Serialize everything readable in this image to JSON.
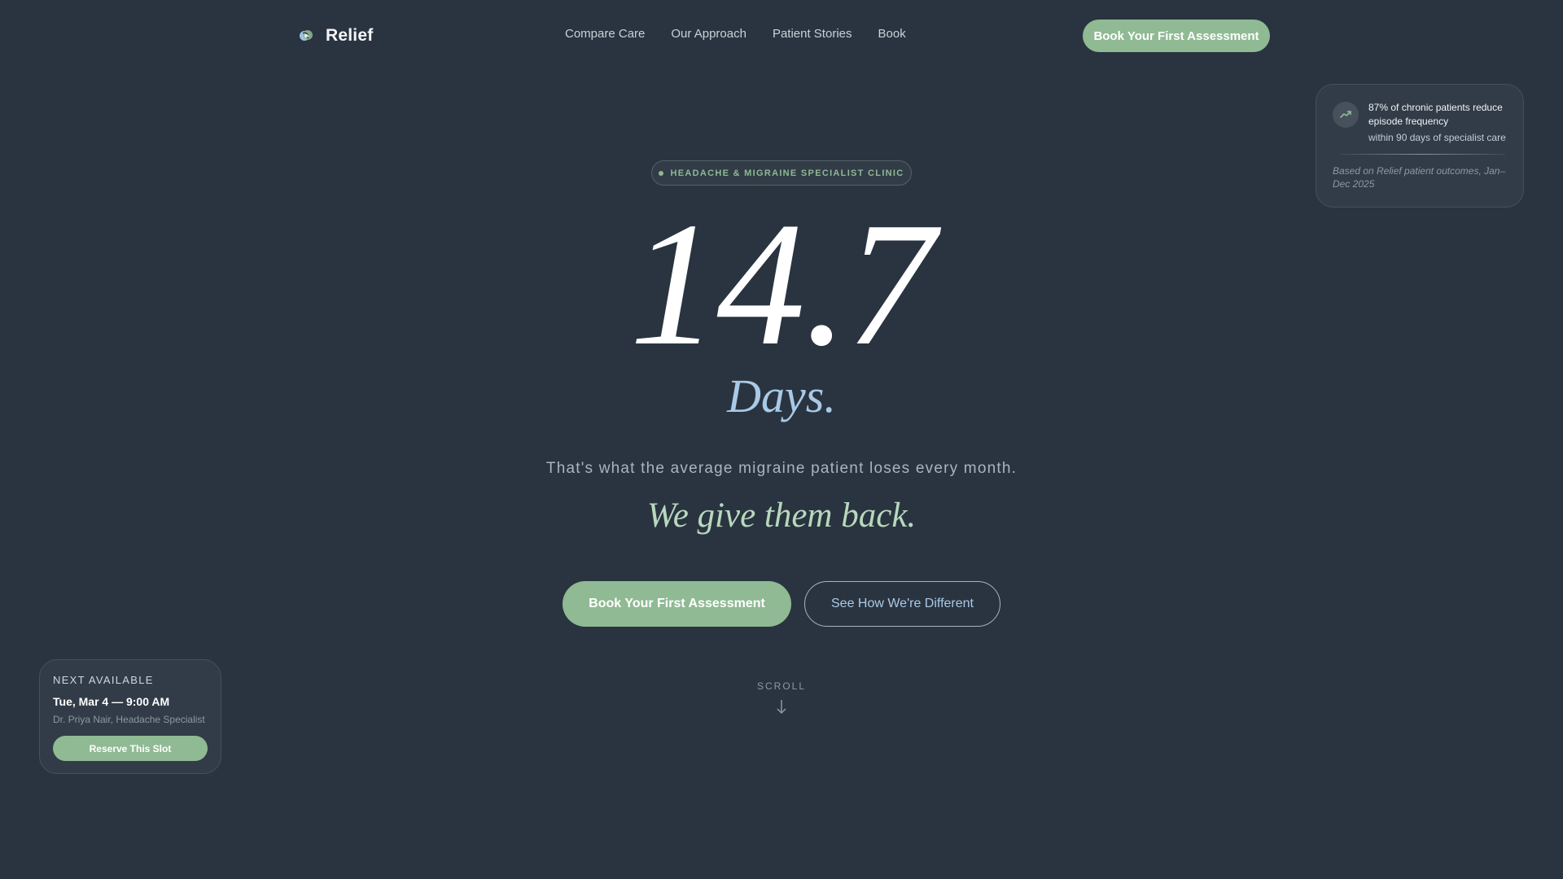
{
  "nav": {
    "brand": "Relief",
    "links": [
      "Compare Care",
      "Our Approach",
      "Patient Stories",
      "Book"
    ],
    "cta_label": "Book Your First Assessment"
  },
  "stat_card": {
    "headline": "87% of chronic patients reduce episode frequency",
    "subline": "within 90 days of specialist care",
    "note": "Based on Relief patient outcomes, Jan–Dec 2025",
    "icon": "trend-up-icon"
  },
  "hero": {
    "badge": "HEADACHE & MIGRAINE SPECIALIST CLINIC",
    "big_number": "14.7",
    "unit": "Days.",
    "tagline": "That's what the average migraine patient loses every month.",
    "sub_tagline": "We give them back.",
    "primary_cta": "Book Your First Assessment",
    "secondary_cta": "See How We're Different",
    "scroll_label": "SCROLL"
  },
  "next_slot": {
    "label": "NEXT AVAILABLE",
    "time": "Tue, Mar 4 — 9:00 AM",
    "doctor": "Dr. Priya Nair, Headache Specialist",
    "button": "Reserve This Slot"
  },
  "colors": {
    "background": "#2a3440",
    "accent_green": "#8fba93",
    "accent_blue": "#a9c9e6",
    "card": "#323c48"
  }
}
